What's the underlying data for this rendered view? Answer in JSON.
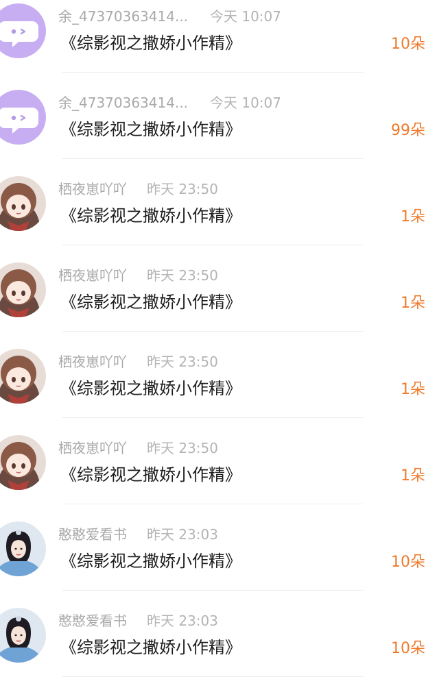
{
  "rows": [
    {
      "avatar": "chat-bubble-avatar",
      "name": "余_47370363414...",
      "time": "今天 10:07",
      "title": "《综影视之撒娇小作精》",
      "amount": "10朵"
    },
    {
      "avatar": "chat-bubble-avatar",
      "name": "余_47370363414...",
      "time": "今天 10:07",
      "title": "《综影视之撒娇小作精》",
      "amount": "99朵"
    },
    {
      "avatar": "anime-girl-avatar",
      "name": "栖夜崽吖吖",
      "time": "昨天 23:50",
      "title": "《综影视之撒娇小作精》",
      "amount": "1朵"
    },
    {
      "avatar": "anime-girl-avatar",
      "name": "栖夜崽吖吖",
      "time": "昨天 23:50",
      "title": "《综影视之撒娇小作精》",
      "amount": "1朵"
    },
    {
      "avatar": "anime-girl-avatar",
      "name": "栖夜崽吖吖",
      "time": "昨天 23:50",
      "title": "《综影视之撒娇小作精》",
      "amount": "1朵"
    },
    {
      "avatar": "anime-girl-avatar",
      "name": "栖夜崽吖吖",
      "time": "昨天 23:50",
      "title": "《综影视之撒娇小作精》",
      "amount": "1朵"
    },
    {
      "avatar": "woman-photo-avatar",
      "name": "憨憨爱看书",
      "time": "昨天 23:03",
      "title": "《综影视之撒娇小作精》",
      "amount": "10朵"
    },
    {
      "avatar": "woman-photo-avatar",
      "name": "憨憨爱看书",
      "time": "昨天 23:03",
      "title": "《综影视之撒娇小作精》",
      "amount": "10朵"
    }
  ],
  "colors": {
    "amount": "#f07a2a",
    "name": "#a9a9a9",
    "title": "#1d1d1d",
    "bubble_avatar_bg": "#c7aef3"
  }
}
